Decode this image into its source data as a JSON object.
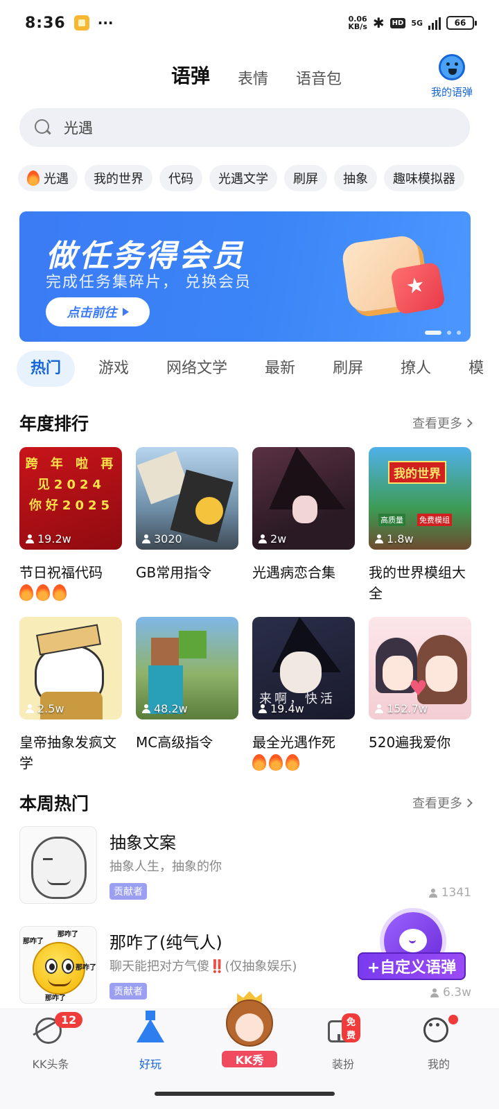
{
  "status": {
    "time": "8:36",
    "net_speed_top": "0.06",
    "net_speed_bottom": "KB/s",
    "bluetooth": "✱",
    "hd": "HD",
    "network": "5G",
    "battery": "66"
  },
  "top_tabs": [
    {
      "label": "语弹",
      "active": true
    },
    {
      "label": "表情",
      "active": false
    },
    {
      "label": "语音包",
      "active": false
    }
  ],
  "my_danmu_label": "我的语弹",
  "search": {
    "value": "光遇"
  },
  "chips": [
    "光遇",
    "我的世界",
    "代码",
    "光遇文学",
    "刷屏",
    "抽象",
    "趣味模拟器"
  ],
  "banner": {
    "title": "做任务得会员",
    "subtitle": "完成任务集碎片， 兑换会员",
    "button": "点击前往",
    "accent": "#3b7bf5"
  },
  "category_tabs": [
    "热门",
    "游戏",
    "网络文学",
    "最新",
    "刷屏",
    "撩人",
    "模"
  ],
  "annual": {
    "title": "年度排行",
    "more": "查看更多",
    "items": [
      {
        "title": "节日祝福代码",
        "count": "19.2w",
        "fires": 3,
        "thumb_text": "跨 年 啦 再见2024 你好2025"
      },
      {
        "title": "GB常用指令",
        "count": "3020",
        "fires": 0
      },
      {
        "title": "光遇病恋合集",
        "count": "2w",
        "fires": 0
      },
      {
        "title": "我的世界模组大全",
        "count": "1.8w",
        "fires": 0,
        "thumb_logo": "我的世界",
        "thumb_tag1": "高质量",
        "thumb_tag2": "免费模组"
      },
      {
        "title": "皇帝抽象发疯文学",
        "count": "2.5w",
        "fires": 0
      },
      {
        "title": "MC高级指令",
        "count": "48.2w",
        "fires": 0
      },
      {
        "title": "最全光遇作死",
        "count": "19.4w",
        "fires": 3,
        "thumb_text": "来啊，快活"
      },
      {
        "title": "520遍我爱你",
        "count": "152.7w",
        "fires": 0
      }
    ]
  },
  "weekly": {
    "title": "本周热门",
    "more": "查看更多",
    "items": [
      {
        "title": "抽象文案",
        "desc": "抽象人生，抽象的你",
        "badge": "贡献者",
        "count": "1341"
      },
      {
        "title": "那咋了(纯气人)",
        "desc": "聊天能把对方气傻‼️(仅抽象娱乐)",
        "badge": "贡献者",
        "count": "6.3w",
        "thumb_tag": "那咋了"
      }
    ]
  },
  "fab_label": "+自定义语弹",
  "bottom_nav": [
    {
      "label": "KK头条",
      "badge": "12",
      "active": false
    },
    {
      "label": "好玩",
      "active": true
    },
    {
      "label": "KK秀",
      "active": false
    },
    {
      "label": "装扮",
      "badge": "免费",
      "active": false
    },
    {
      "label": "我的",
      "active": false
    }
  ]
}
